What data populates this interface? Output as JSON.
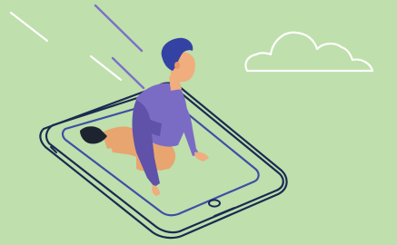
{
  "colors": {
    "background": "#bfdfac",
    "outline_dark": "#1b2a52",
    "device_screen_line": "#3d4fa6",
    "shirt": "#7a6cc4",
    "shirt_shadow": "#5f52a8",
    "pants": "#e8a56f",
    "skin": "#f0ad7d",
    "hair": "#3443a3",
    "shoe": "#1d2430",
    "speed_lines": "#7d70c8",
    "wind_lines": "#ffffff",
    "cloud_line": "#ffffff"
  },
  "icons": {
    "person": "person-kneeling-icon",
    "tablet": "tablet-device-icon",
    "cloud": "cloud-outline-icon",
    "speed": "speed-lines-icon"
  }
}
